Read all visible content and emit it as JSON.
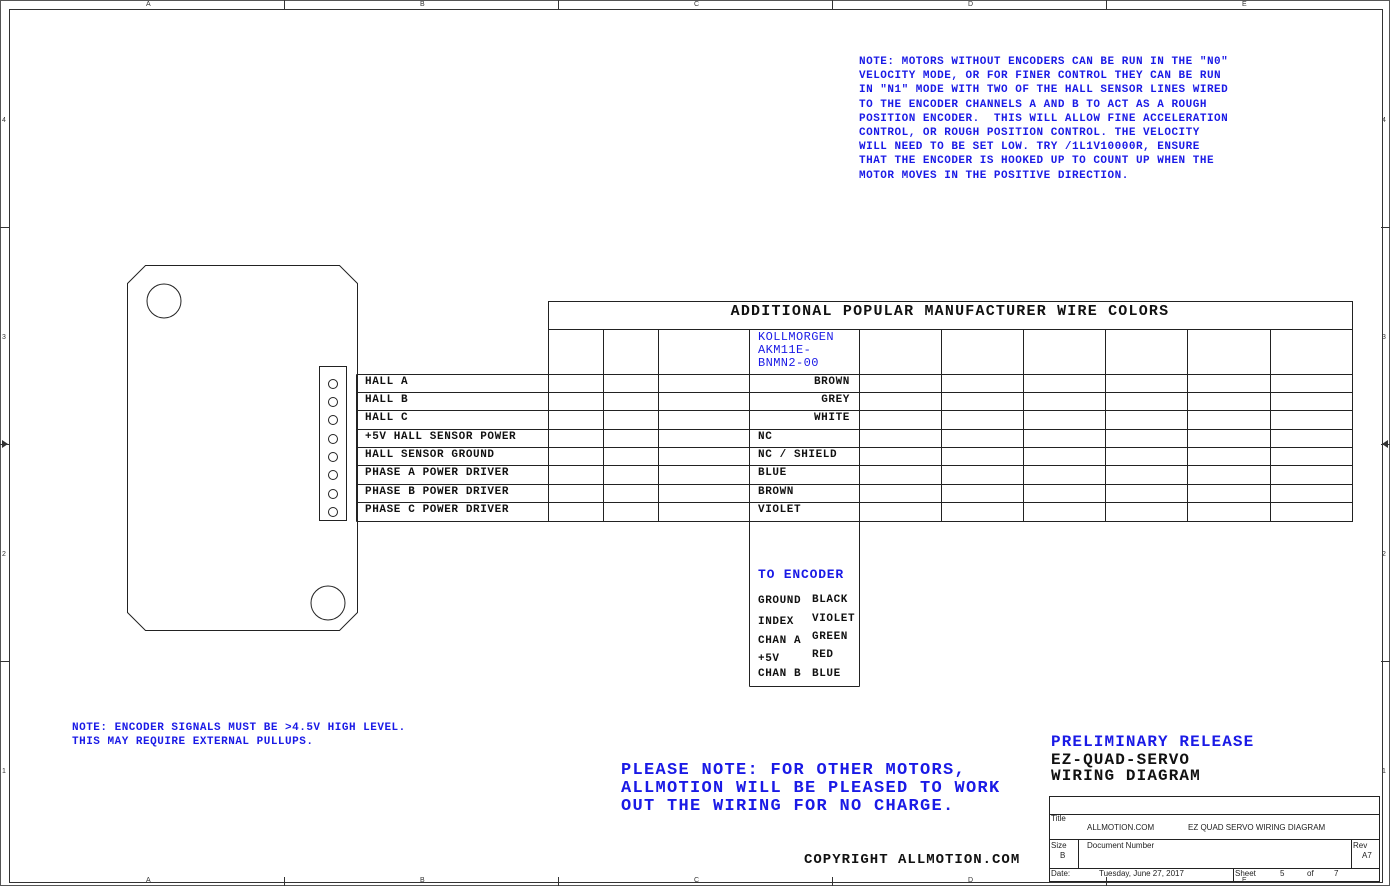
{
  "zones": {
    "top": [
      "A",
      "B",
      "C",
      "D",
      "E"
    ],
    "bottom": [
      "A",
      "B",
      "C",
      "D",
      "E"
    ],
    "left": [
      "4",
      "3",
      "2",
      "1"
    ],
    "right": [
      "4",
      "3",
      "2",
      "1"
    ]
  },
  "motor_note": "NOTE: MOTORS WITHOUT ENCODERS CAN BE RUN IN THE \"N0\"\nVELOCITY MODE, OR FOR FINER CONTROL THEY CAN BE RUN\nIN \"N1\" MODE WITH TWO OF THE HALL SENSOR LINES WIRED\nTO THE ENCODER CHANNELS A AND B TO ACT AS A ROUGH\nPOSITION ENCODER.  THIS WILL ALLOW FINE ACCELERATION\nCONTROL, OR ROUGH POSITION CONTROL. THE VELOCITY\nWILL NEED TO BE SET LOW. TRY /1L1V10000R, ENSURE\nTHAT THE ENCODER IS HOOKED UP TO COUNT UP WHEN THE\nMOTOR MOVES IN THE POSITIVE DIRECTION.",
  "table_title": "ADDITIONAL POPULAR MANUFACTURER WIRE COLORS",
  "manufacturer_header": "KOLLMORGEN\nAKM11E-\nBNMN2-00",
  "pins": [
    {
      "label": "HALL A",
      "color": "BROWN",
      "align": "right"
    },
    {
      "label": "HALL B",
      "color": "GREY",
      "align": "right"
    },
    {
      "label": "HALL C",
      "color": "WHITE",
      "align": "right"
    },
    {
      "label": "+5V HALL SENSOR POWER",
      "color": "NC",
      "align": "left"
    },
    {
      "label": "HALL SENSOR GROUND",
      "color": "NC / SHIELD",
      "align": "left"
    },
    {
      "label": "PHASE A POWER DRIVER",
      "color": "BLUE",
      "align": "left"
    },
    {
      "label": "PHASE B POWER DRIVER",
      "color": "BROWN",
      "align": "left"
    },
    {
      "label": "PHASE C POWER DRIVER",
      "color": "VIOLET",
      "align": "left"
    }
  ],
  "encoder": {
    "title": "TO ENCODER",
    "signals": [
      "GROUND",
      "INDEX",
      "CHAN A",
      "+5V",
      "CHAN B"
    ],
    "colors": [
      "BLACK",
      "VIOLET",
      "GREEN",
      "RED",
      "BLUE"
    ]
  },
  "encoder_note": "NOTE: ENCODER SIGNALS MUST BE >4.5V HIGH LEVEL.\nTHIS MAY REQUIRE EXTERNAL PULLUPS.",
  "please_note": "PLEASE NOTE: FOR OTHER MOTORS,\nALLMOTION WILL BE PLEASED TO WORK\nOUT THE WIRING FOR NO CHARGE.",
  "copyright": "COPYRIGHT ALLMOTION.COM",
  "release": {
    "status": "PRELIMINARY RELEASE",
    "product": "EZ-QUAD-SERVO",
    "doc": "WIRING DIAGRAM"
  },
  "title_block": {
    "title_label": "Title",
    "company": "ALLMOTION.COM",
    "title_value": "EZ QUAD SERVO   WIRING DIAGRAM",
    "size_label": "Size",
    "size_value": "B",
    "docnum_label": "Document Number",
    "rev_label": "Rev",
    "rev_value": "A7",
    "date_label": "Date:",
    "date_value": "Tuesday, June 27, 2017",
    "sheet_label": "Sheet",
    "sheet_value": "5",
    "of_label": "of",
    "of_value": "7"
  },
  "colors": {
    "blue_text": "#1a1ae6",
    "line": "#222222"
  }
}
